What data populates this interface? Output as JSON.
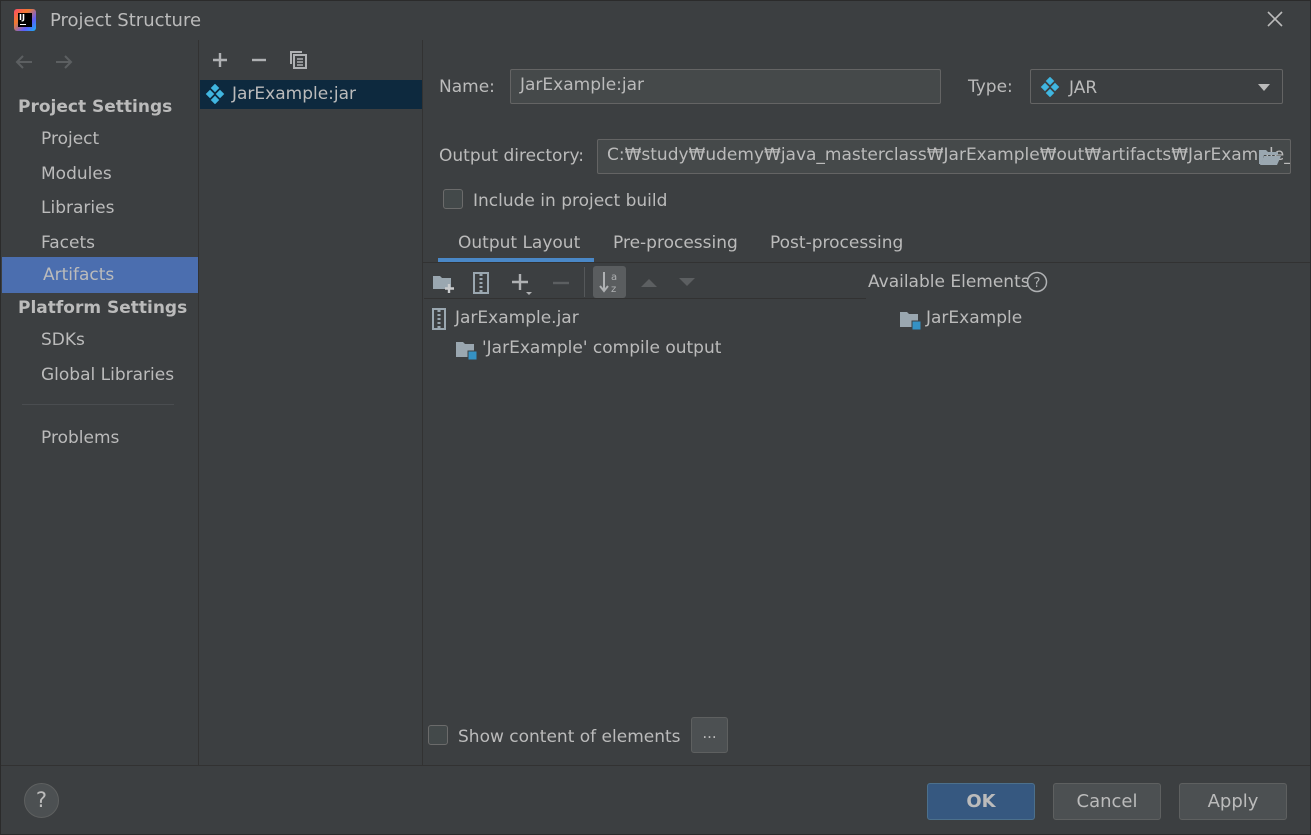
{
  "window": {
    "title": "Project Structure"
  },
  "nav": {
    "project_settings_header": "Project Settings",
    "project_items": [
      "Project",
      "Modules",
      "Libraries",
      "Facets",
      "Artifacts"
    ],
    "platform_settings_header": "Platform Settings",
    "platform_items": [
      "SDKs",
      "Global Libraries"
    ],
    "problems": "Problems",
    "selected": "Artifacts"
  },
  "artifacts": {
    "items": [
      "JarExample:jar"
    ]
  },
  "details": {
    "name_label": "Name:",
    "name_value": "JarExample:jar",
    "type_label": "Type:",
    "type_value": "JAR",
    "output_dir_label": "Output directory:",
    "output_dir_value": "C:₩study₩udemy₩java_masterclass₩JarExample₩out₩artifacts₩JarExample_jar",
    "include_build_label": "Include in project build",
    "include_build_checked": false
  },
  "tabs": [
    "Output Layout",
    "Pre-processing",
    "Post-processing"
  ],
  "active_tab": "Output Layout",
  "output_layout": {
    "tree": [
      {
        "label": "JarExample.jar",
        "icon": "jar-icon"
      },
      {
        "label": "'JarExample' compile output",
        "icon": "module-folder-icon"
      }
    ],
    "available_header": "Available Elements",
    "available": [
      {
        "label": "JarExample",
        "icon": "module-folder-icon"
      }
    ],
    "show_content_label": "Show content of elements",
    "show_content_checked": false,
    "dots_label": "..."
  },
  "footer": {
    "help": "?",
    "ok": "OK",
    "cancel": "Cancel",
    "apply": "Apply"
  },
  "colors": {
    "selection": "#4b6eaf",
    "accent": "#4a88c7",
    "list_selection": "#0d293e",
    "module_blue": "#3592c4",
    "icon_gray": "#afb1b3"
  }
}
